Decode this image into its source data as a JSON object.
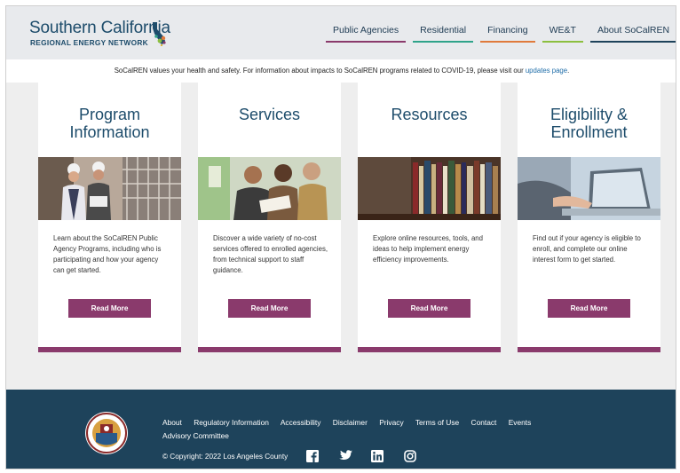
{
  "header": {
    "logo_top": "Southern California",
    "logo_bottom": "REGIONAL ENERGY NETWORK",
    "nav": [
      {
        "label": "Public Agencies",
        "color": "#8a3a6c"
      },
      {
        "label": "Residential",
        "color": "#2fa38a"
      },
      {
        "label": "Financing",
        "color": "#e07a3c"
      },
      {
        "label": "WE&T",
        "color": "#8cbf3f"
      },
      {
        "label": "About SoCalREN",
        "color": "#1e435b"
      }
    ]
  },
  "notice": {
    "text": "SoCalREN values your health and safety. For information about impacts to SoCalREN programs related to COVID-19, please visit our",
    "link": "updates page",
    "end": "."
  },
  "cards": [
    {
      "title_line1": "Program",
      "title_line2": "Information",
      "image_icon": "engineers-photo",
      "text": "Learn about the SoCalREN Public Agency Programs, including who is participating and how your agency can get started.",
      "button": "Read More"
    },
    {
      "title_line1": "Services",
      "title_line2": "",
      "image_icon": "team-meeting-photo",
      "text": "Discover a wide variety of no-cost services offered to enrolled agencies, from technical support to staff guidance.",
      "button": "Read More"
    },
    {
      "title_line1": "Resources",
      "title_line2": "",
      "image_icon": "bookshelf-photo",
      "text": "Explore online resources, tools, and ideas to help implement energy efficiency improvements.",
      "button": "Read More"
    },
    {
      "title_line1": "Eligibility &",
      "title_line2": "Enrollment",
      "image_icon": "laptop-typing-photo",
      "text": "Find out if your agency is eligible to enroll, and complete our online interest form to get started.",
      "button": "Read More"
    }
  ],
  "footer": {
    "links": [
      "About",
      "Regulatory Information",
      "Accessibility",
      "Disclaimer",
      "Privacy",
      "Terms of Use",
      "Contact",
      "Events",
      "Advisory Committee"
    ],
    "copyright": "© Copyright: 2022 Los Angeles County",
    "social_icons": [
      "facebook-icon",
      "twitter-icon",
      "linkedin-icon",
      "instagram-icon"
    ]
  },
  "colors": {
    "brand_blue": "#1d4c6b",
    "accent_plum": "#8a3a6c",
    "footer_bg": "#1e435b",
    "link_blue": "#1d6ca8"
  }
}
